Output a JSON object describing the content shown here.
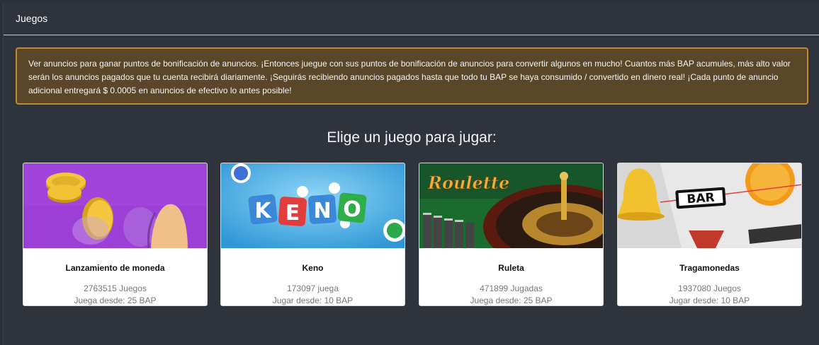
{
  "header": {
    "title": "Juegos"
  },
  "notice": {
    "text": "Ver anuncios para ganar puntos de bonificación de anuncios. ¡Entonces juegue con sus puntos de bonificación de anuncios para convertir algunos en mucho! Cuantos más BAP acumules, más alto valor serán los anuncios pagados que tu cuenta recibirá diariamente. ¡Seguirás recibiendo anuncios pagados hasta que todo tu BAP se haya consumido / convertido en dinero real! ¡Cada punto de anuncio adicional entregará $ 0.0005 en anuncios de efectivo lo antes posible!"
  },
  "heading": "Elige un juego para jugar:",
  "games": [
    {
      "name": "Lanzamiento de moneda",
      "plays": "2763515 Juegos",
      "min": "Juega desde: 25 BAP"
    },
    {
      "name": "Keno",
      "plays": "173097 juega",
      "min": "Jugar desde: 10 BAP",
      "logo": "KENO"
    },
    {
      "name": "Ruleta",
      "plays": "471899 Jugadas",
      "min": "Juega desde: 25 BAP",
      "logo": "Roulette"
    },
    {
      "name": "Tragamonedas",
      "plays": "1937080 Juegos",
      "min": "Jugar desde: 10 BAP",
      "logo": "BAR"
    }
  ],
  "colors": {
    "background": "#2e333c",
    "notice_bg": "#5a472a",
    "notice_border": "#c18a2b",
    "coin_bg": "#9b3fd6",
    "keno_bg": "#4fb6e8",
    "roulette_bg": "#1c6b2e"
  }
}
